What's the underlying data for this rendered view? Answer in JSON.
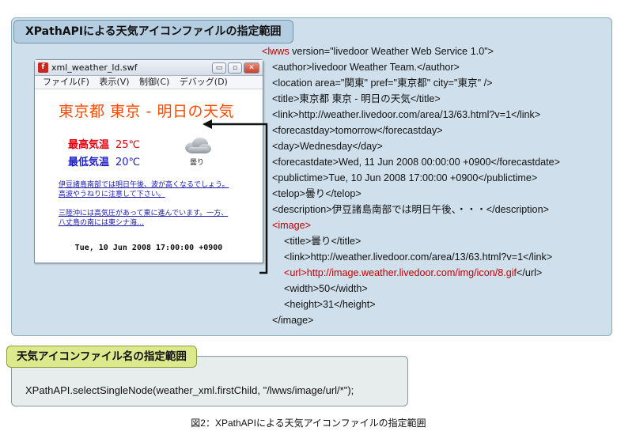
{
  "top_panel": {
    "title": "XPathAPIによる天気アイコンファイルの指定範囲"
  },
  "window": {
    "title": "xml_weather_ld.swf",
    "controls": [
      "▭",
      "▫",
      "✕"
    ],
    "menu": [
      "ファイル(F)",
      "表示(V)",
      "制御(C)",
      "デバッグ(D)"
    ]
  },
  "swf": {
    "heading": "東京都 東京 - 明日の天気",
    "max_label": "最高気温",
    "max_value": "25℃",
    "min_label": "最低気温",
    "min_value": "20℃",
    "telop": "曇り",
    "desc1": "伊豆諸島南部では明日午後、波が高くなるでしょう。高波やうねりに注意して下さい。",
    "desc2": "三陸沖には高気圧があって東に進んでいます。一方、八丈島の南には東シナ海…",
    "pubtime": "Tue, 10 Jun 2008 17:00:00 +0900",
    "colors": {
      "heading": "#ff4a00",
      "max": "#e0000e",
      "min": "#1c1cc8"
    }
  },
  "xml": {
    "root_open_tag": "<lwws",
    "root_open_rest": " version=\"livedoor Weather Web Service 1.0\">",
    "lines": [
      "<author>livedoor Weather Team.</author>",
      "<location area=\"関東\" pref=\"東京都\" city=\"東京\" />",
      "<title>東京都 東京 - 明日の天気</title>",
      "<link>http://weather.livedoor.com/area/13/63.html?v=1</link>",
      "<forecastday>tomorrow</forecastday>",
      "<day>Wednesday</day>",
      "<forecastdate>Wed, 11 Jun 2008 00:00:00 +0900</forecastdate>",
      "<publictime>Tue, 10 Jun 2008 17:00:00 +0900</publictime>",
      "<telop>曇り</telop>",
      "<description>伊豆諸島南部では明日午後、・・・</description>"
    ],
    "image_open": "<image>",
    "image_title": "<title>曇り</title>",
    "image_link": "<link>http://weather.livedoor.com/area/13/63.html?v=1</link>",
    "url_open": "<url>",
    "url_value": "http://image.weather.livedoor.com/img/icon/8.gif",
    "url_close": "</url>",
    "width": "<width>50</width>",
    "height": "<height>31</height>",
    "image_close": "</image>",
    "highlight_color": "#c00000"
  },
  "bottom_panel": {
    "title": "天気アイコンファイル名の指定範囲",
    "code": "XPathAPI.selectSingleNode(weather_xml.firstChild, \"/lwws/image/url/*\");"
  },
  "caption": "図2：XPathAPIによる天気アイコンファイルの指定範囲"
}
